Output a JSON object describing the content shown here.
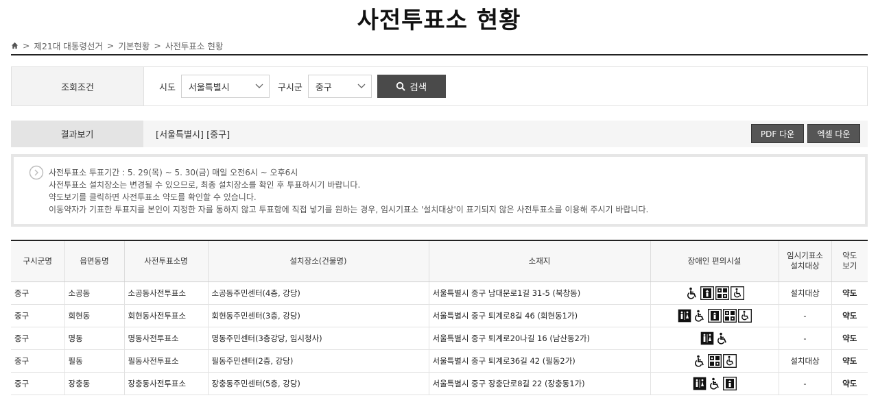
{
  "page": {
    "title": "사전투표소 현황"
  },
  "breadcrumb": {
    "items": [
      "제21대 대통령선거",
      "기본현황",
      "사전투표소 현황"
    ],
    "separator": ">"
  },
  "search": {
    "section_label": "조회조건",
    "sido_label": "시도",
    "sido_value": "서울특별시",
    "gu_label": "구시군",
    "gu_value": "중구",
    "button_label": "검색"
  },
  "result": {
    "section_label": "결과보기",
    "criteria": "[서울특별시] [중구]",
    "pdf_label": "PDF 다운",
    "excel_label": "엑셀 다운"
  },
  "notice": {
    "lines": [
      "사전투표소 투표기간 : 5. 29(목) ~ 5. 30(금) 매일 오전6시 ~ 오후6시",
      "사전투표소 설치장소는 변경될 수 있으므로, 최종 설치장소를 확인 후 투표하시기 바랍니다.",
      "약도보기를 클릭하면 사전투표소 약도를 확인할 수 있습니다.",
      "이동약자가 기표한 투표지를 본인이 지정한 자를 통하지 않고 투표함에 직접 넣기를 원하는 경우, 임시기표소 '설치대상'이 표기되지 않은 사전투표소를 이용해 주시기 바랍니다."
    ]
  },
  "table": {
    "headers": {
      "gu": "구시군명",
      "dong": "읍면동명",
      "station": "사전투표소명",
      "place": "설치장소(건물명)",
      "address": "소재지",
      "facility": "장애인 편의시설",
      "booth_1": "임시기표소",
      "booth_2": "설치대상",
      "map_1": "약도",
      "map_2": "보기"
    },
    "rows": [
      {
        "gu": "중구",
        "dong": "소공동",
        "station": "소공동사전투표소",
        "place": "소공동주민센터(4층, 강당)",
        "address": "서울특별시 중구 남대문로1길 31-5 (북창동)",
        "icons": [
          "wheelchair-icon",
          "elevator-icon",
          "braille-icon",
          "wheelchair-toilet-icon"
        ],
        "booth": "설치대상",
        "map": "약도"
      },
      {
        "gu": "중구",
        "dong": "회현동",
        "station": "회현동사전투표소",
        "place": "회현동주민센터(3층, 강당)",
        "address": "서울특별시 중구 퇴계로8길 46 (회현동1가)",
        "icons": [
          "restroom-icon",
          "wheelchair-icon",
          "elevator-icon",
          "braille-icon",
          "wheelchair-toilet-icon"
        ],
        "booth": "-",
        "map": "약도"
      },
      {
        "gu": "중구",
        "dong": "명동",
        "station": "명동사전투표소",
        "place": "명동주민센터(3층강당, 임시청사)",
        "address": "서울특별시 중구 퇴계로20나길 16 (남산동2가)",
        "icons": [
          "restroom-icon",
          "wheelchair-icon"
        ],
        "booth": "-",
        "map": "약도"
      },
      {
        "gu": "중구",
        "dong": "필동",
        "station": "필동사전투표소",
        "place": "필동주민센터(2층, 강당)",
        "address": "서울특별시 중구 퇴계로36길 42 (필동2가)",
        "icons": [
          "wheelchair-icon",
          "braille-icon",
          "wheelchair-toilet-icon"
        ],
        "booth": "설치대상",
        "map": "약도"
      },
      {
        "gu": "중구",
        "dong": "장충동",
        "station": "장충동사전투표소",
        "place": "장충동주민센터(5층, 강당)",
        "address": "서울특별시 중구 장충단로8길 22 (장충동1가)",
        "icons": [
          "restroom-icon",
          "wheelchair-icon",
          "elevator-icon"
        ],
        "booth": "-",
        "map": "약도"
      }
    ]
  }
}
